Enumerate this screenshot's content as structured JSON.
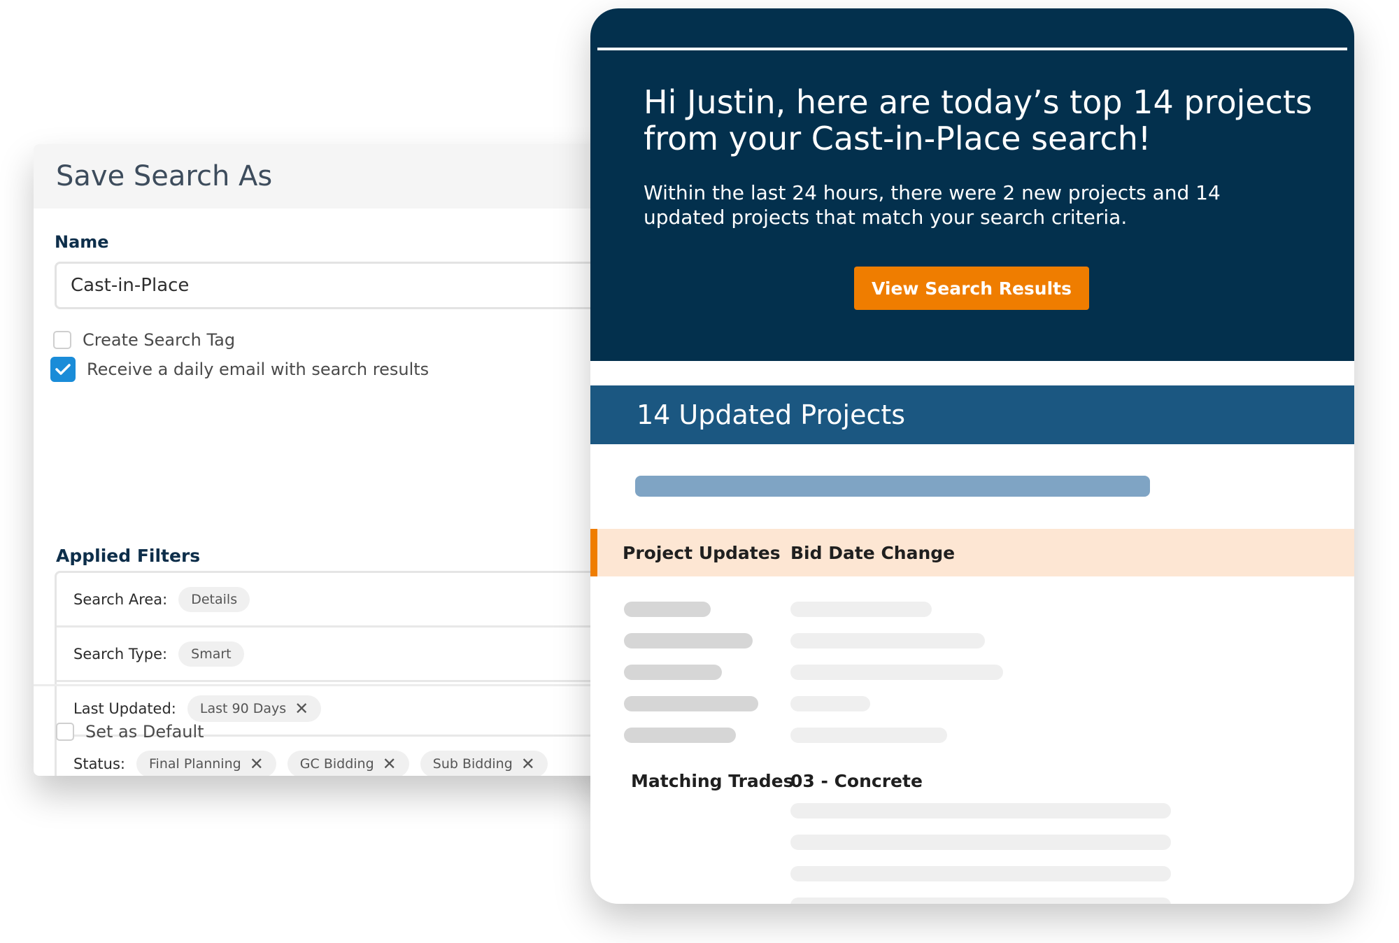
{
  "save_search": {
    "title": "Save Search As",
    "name_label": "Name",
    "name_value": "Cast-in-Place",
    "create_tag_label": "Create Search Tag",
    "create_tag_checked": false,
    "daily_email_label": "Receive a daily email with search results",
    "daily_email_checked": true,
    "applied_filters_label": "Applied Filters",
    "filters": [
      {
        "label": "Search Area:",
        "chips": [
          "Details"
        ]
      },
      {
        "label": "Search Type:",
        "chips": [
          "Smart"
        ]
      },
      {
        "label": "Last Updated:",
        "chips": [
          "Last 90 Days"
        ]
      },
      {
        "label": "Status:",
        "chips": [
          "Final Planning",
          "GC Bidding",
          "Sub Bidding"
        ]
      }
    ],
    "set_default_label": "Set as Default",
    "set_default_checked": false
  },
  "email": {
    "headline": "Hi Justin, here are today’s top 14 projects from your Cast-in-Place search!",
    "body": "Within the last 24 hours, there were 2 new projects and 14 updated projects that match your search criteria.",
    "cta_label": "View Search Results",
    "updated_title": "14 Updated Projects",
    "project_updates_label": "Project Updates",
    "project_updates_value": "Bid Date Change",
    "matching_trades_label": "Matching Trades",
    "matching_trades_value": "03 - Concrete"
  },
  "colors": {
    "navy": "#03304d",
    "blue_band": "#1b5781",
    "orange": "#ef7d00",
    "peach": "#fde6d3",
    "checkbox_blue": "#1a8cd8"
  },
  "icons": {
    "check": "check-icon",
    "remove": "close-icon"
  }
}
